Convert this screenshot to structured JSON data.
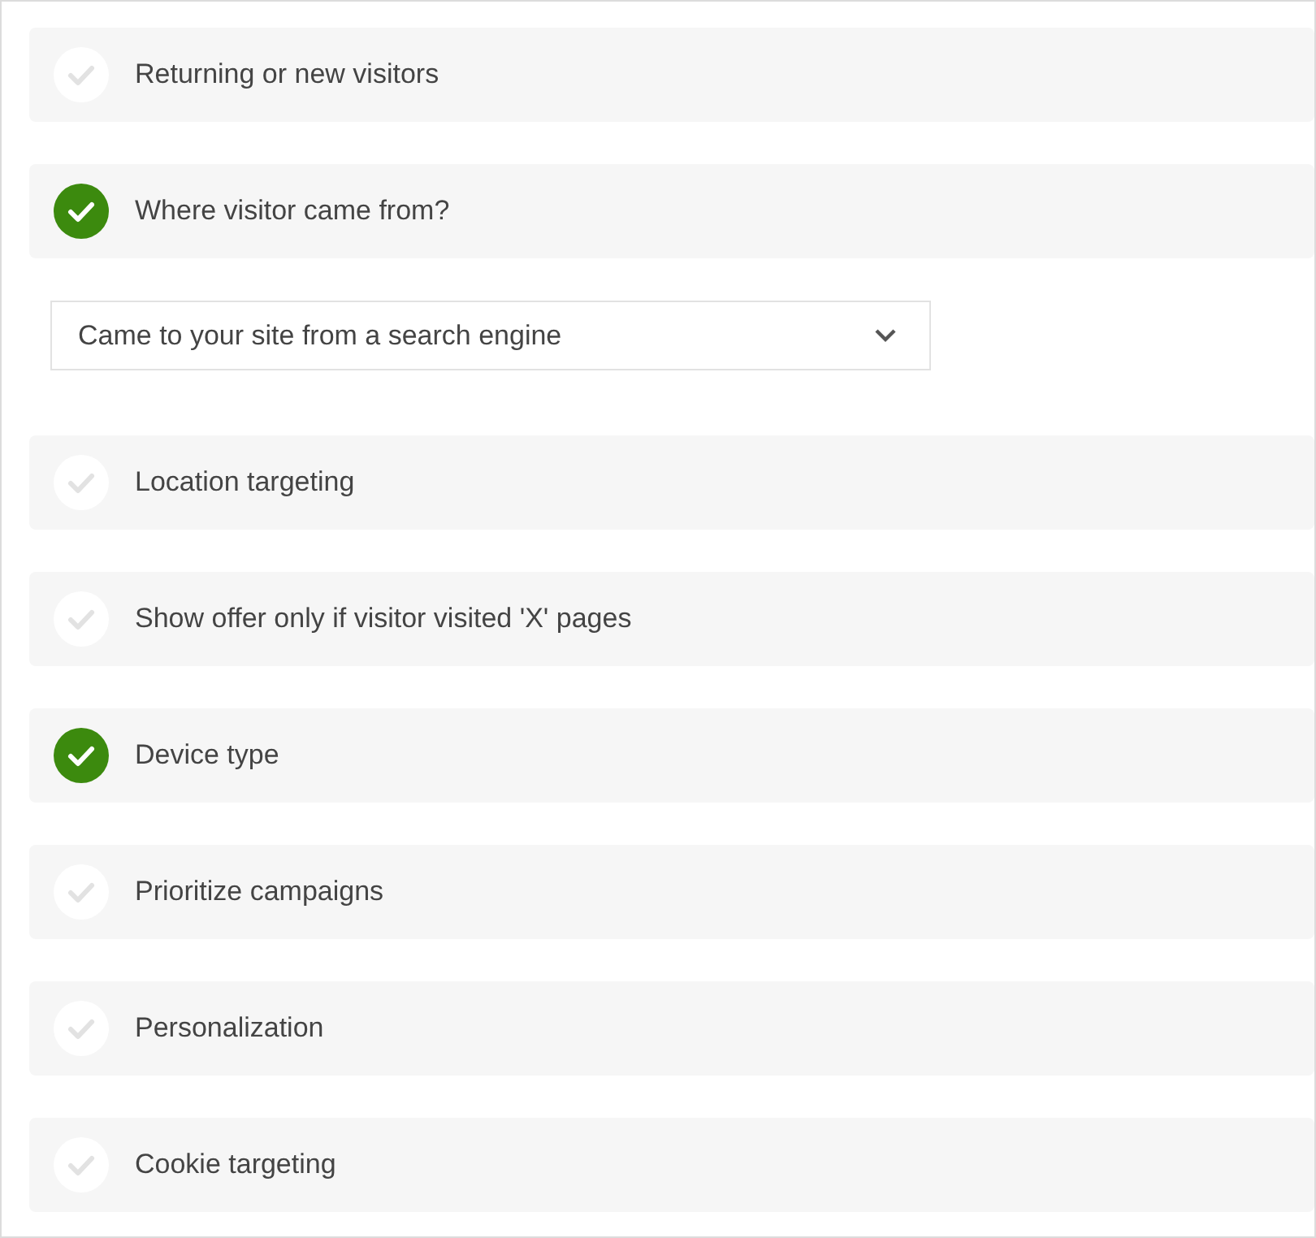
{
  "settings": [
    {
      "label": "Returning or new visitors",
      "checked": false
    },
    {
      "label": "Where visitor came from?",
      "checked": true,
      "dropdown": {
        "value": "Came to your site from a search engine"
      }
    },
    {
      "label": "Location targeting",
      "checked": false
    },
    {
      "label": "Show offer only if visitor visited 'X' pages",
      "checked": false
    },
    {
      "label": "Device type",
      "checked": true
    },
    {
      "label": "Prioritize campaigns",
      "checked": false
    },
    {
      "label": "Personalization",
      "checked": false
    },
    {
      "label": "Cookie targeting",
      "checked": false
    }
  ]
}
